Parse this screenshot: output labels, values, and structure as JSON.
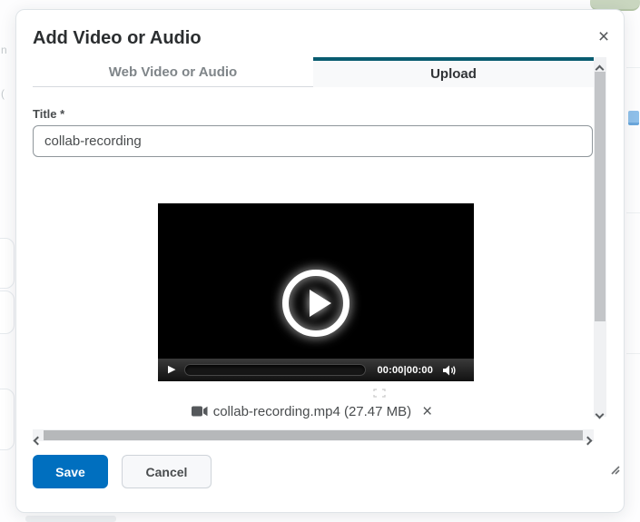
{
  "dialog": {
    "title": "Add Video or Audio",
    "tabs": {
      "web": "Web Video or Audio",
      "upload": "Upload"
    },
    "form": {
      "title_label": "Title *",
      "title_value": "collab-recording"
    },
    "player": {
      "time": "00:00|00:00"
    },
    "attachment": {
      "label": "collab-recording.mp4 (27.47 MB)"
    },
    "actions": {
      "save": "Save",
      "cancel": "Cancel"
    }
  },
  "icons": {
    "close": "×",
    "remove": "×",
    "play_small": "▶"
  },
  "background": {
    "left_text_fragment_1": "n",
    "left_text_fragment_2": "("
  },
  "colors": {
    "accent_teal": "#095c70",
    "primary_blue": "#006fbf",
    "badge_green": "#c9d6bf",
    "player_black": "#000000"
  }
}
